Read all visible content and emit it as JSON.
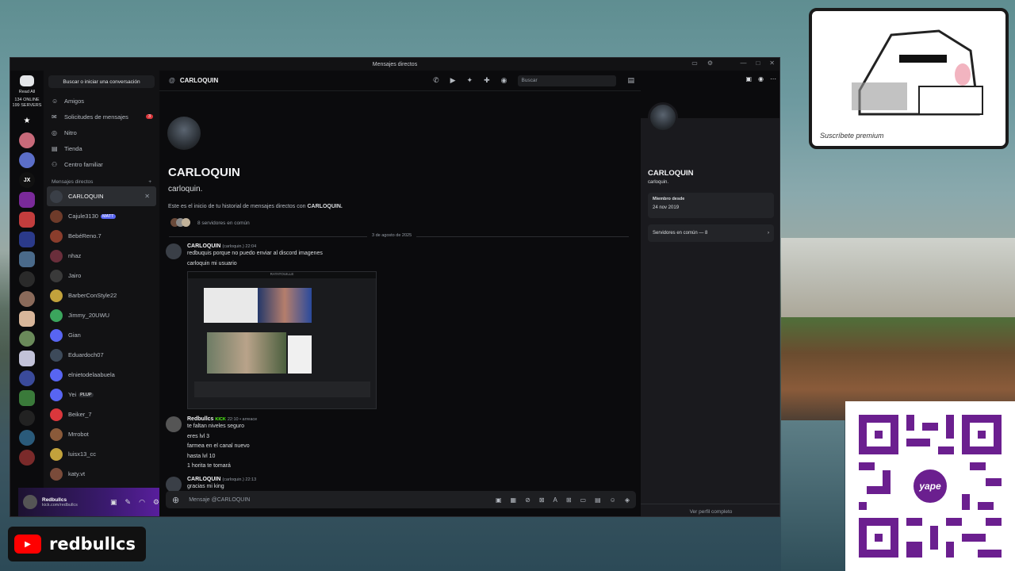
{
  "window": {
    "title": "Mensajes directos"
  },
  "rail": {
    "read_all": "Read All",
    "online": "134 ONLINE",
    "servers": "199 SERVERS",
    "jx": "JX"
  },
  "dm_panel": {
    "search_label": "Buscar o iniciar una conversación",
    "nav": [
      {
        "label": "Amigos",
        "icon": "friends-icon"
      },
      {
        "label": "Solicitudes de mensajes",
        "icon": "mail-icon",
        "badge": "3"
      },
      {
        "label": "Nitro",
        "icon": "nitro-icon"
      },
      {
        "label": "Tienda",
        "icon": "shop-icon"
      },
      {
        "label": "Centro familiar",
        "icon": "family-icon"
      }
    ],
    "section_title": "Mensajes directos",
    "dms": [
      {
        "name": "CARLOQUIN",
        "color": "#3a3f47"
      },
      {
        "name": "Cajule3130",
        "tag": "MATT",
        "color": "#6e3b2a"
      },
      {
        "name": "BebéReno.7",
        "color": "#8a3d2c"
      },
      {
        "name": "nhaz",
        "color": "#6a2e3b"
      },
      {
        "name": "Jairo",
        "color": "#3a3a3a"
      },
      {
        "name": "BarberConStyle22",
        "color": "#c2a23c"
      },
      {
        "name": "Jimmy_20UWU",
        "color": "#3ba55d"
      },
      {
        "name": "Gian",
        "color": "#5865f2"
      },
      {
        "name": "Eduardoch07",
        "color": "#3d4a5a"
      },
      {
        "name": "elnietodelaabuela",
        "color": "#5865f2"
      },
      {
        "name": "Yei",
        "tag": "PLUP",
        "color": "#5865f2"
      },
      {
        "name": "Beiker_7",
        "color": "#da373c"
      },
      {
        "name": "Mrrobot",
        "color": "#8a5a3a"
      },
      {
        "name": "luisx13_cc",
        "color": "#c2a23c"
      },
      {
        "name": "katy.vt",
        "color": "#7a4b3a"
      }
    ]
  },
  "user_panel": {
    "name": "Redbullcs",
    "sub": "kick.com/redbullcs"
  },
  "chat": {
    "header_name": "CARLOQUIN",
    "search_placeholder": "Buscar",
    "intro_name": "CARLOQUIN",
    "intro_handle": "carloquin.",
    "intro_text": "Este es el inicio de tu historial de mensajes directos con",
    "intro_text_name": "CARLOQUIN.",
    "mutual": "8 servidores en común",
    "date_divider": "3 de agosto de 2025",
    "messages": [
      {
        "author": "CARLOQUIN",
        "meta": "(carloquin.) 22:04",
        "lines": [
          "redbuquis porque no puedo enviar al discord imagenes",
          "carloquin mi usuario"
        ]
      },
      {
        "author": "Redbullcs",
        "badge": "KICK",
        "meta": "22:10 • arreace",
        "lines": [
          "te faltan niveles seguro",
          "eres lvl 3",
          "farmea en el canal nuevo",
          "hasta lvl 10",
          "1 horita te tomará"
        ]
      },
      {
        "author": "CARLOQUIN",
        "meta": "(carloquin.) 22:13",
        "lines": [
          "gracias mi king"
        ]
      }
    ],
    "attachment_title": "RATATOUILLE",
    "composer_placeholder": "Mensaje @CARLOQUIN"
  },
  "profile": {
    "name": "CARLOQUIN",
    "handle": "carloquin.",
    "member_since_label": "Miembro desde",
    "member_since": "24 nov 2019",
    "mutual_servers": "Servidores en común — 8",
    "full_profile": "Ver perfil completo"
  },
  "overlay": {
    "channel": "redbullcs",
    "qr_brand": "yape",
    "cam_sign": "Suscríbete premium"
  }
}
